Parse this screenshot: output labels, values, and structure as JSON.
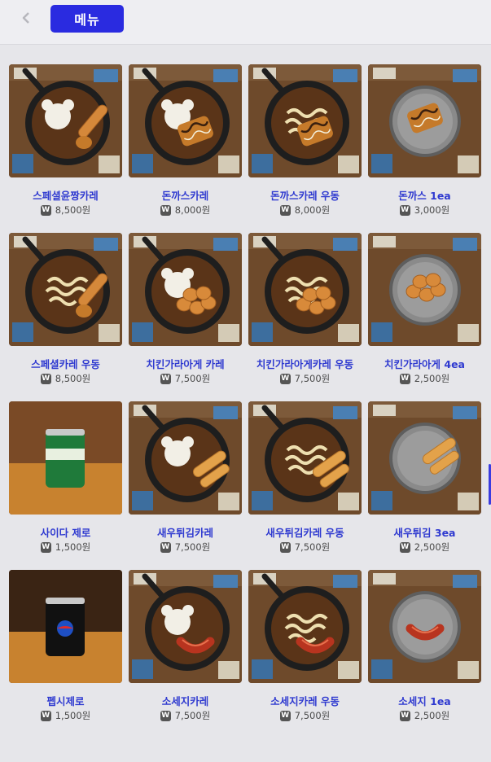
{
  "header": {
    "back_icon": "chevron-left-icon",
    "tab_label": "메뉴"
  },
  "currency_symbol": "W",
  "items": [
    {
      "name": "스페셜윤짱카레",
      "price": "8,500원",
      "type": "curry",
      "topping": "special"
    },
    {
      "name": "돈까스카레",
      "price": "8,000원",
      "type": "curry",
      "topping": "katsu"
    },
    {
      "name": "돈까스카레 우동",
      "price": "8,000원",
      "type": "udon",
      "topping": "katsu"
    },
    {
      "name": "돈까스 1ea",
      "price": "3,000원",
      "type": "side",
      "topping": "katsu"
    },
    {
      "name": "스페셜카레 우동",
      "price": "8,500원",
      "type": "udon",
      "topping": "special"
    },
    {
      "name": "치킨가라아게 카레",
      "price": "7,500원",
      "type": "curry",
      "topping": "chicken"
    },
    {
      "name": "치킨가라아게카레 우동",
      "price": "7,500원",
      "type": "udon",
      "topping": "chicken"
    },
    {
      "name": "치킨가라아게 4ea",
      "price": "2,500원",
      "type": "side",
      "topping": "chicken"
    },
    {
      "name": "사이다 제로",
      "price": "1,500원",
      "type": "can",
      "topping": "cider"
    },
    {
      "name": "새우튀김카레",
      "price": "7,500원",
      "type": "curry",
      "topping": "shrimp"
    },
    {
      "name": "새우튀김카레 우동",
      "price": "7,500원",
      "type": "udon",
      "topping": "shrimp"
    },
    {
      "name": "새우튀김 3ea",
      "price": "2,500원",
      "type": "side",
      "topping": "shrimp"
    },
    {
      "name": "펩시제로",
      "price": "1,500원",
      "type": "can",
      "topping": "pepsi"
    },
    {
      "name": "소세지카레",
      "price": "7,500원",
      "type": "curry",
      "topping": "sausage"
    },
    {
      "name": "소세지카레 우동",
      "price": "7,500원",
      "type": "udon",
      "topping": "sausage"
    },
    {
      "name": "소세지 1ea",
      "price": "2,500원",
      "type": "side",
      "topping": "sausage"
    }
  ],
  "colors": {
    "accent": "#2a2be0",
    "item_name": "#2f3ad0",
    "background": "#e6e6ea",
    "curry": "#5a3418",
    "pan": "#1e1e1e",
    "rice": "#f2efe6"
  }
}
